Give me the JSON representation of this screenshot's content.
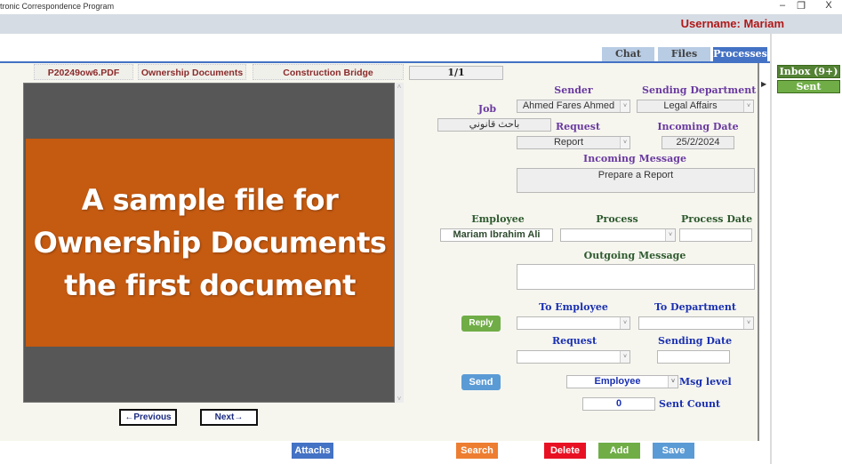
{
  "window": {
    "title": "tronic Correspondence Program",
    "minimize_glyph": "–",
    "restore_glyph": "❐",
    "close_glyph": "X"
  },
  "header": {
    "username_label": "Username: Mariam"
  },
  "tabs": [
    {
      "label": "Chat",
      "active": false
    },
    {
      "label": "Files",
      "active": false
    },
    {
      "label": "Processes",
      "active": true
    }
  ],
  "sidebar": {
    "inbox_label": "Inbox (9+)",
    "sent_label": "Sent"
  },
  "document_tabs": {
    "file_name": "P20249ow6.PDF",
    "category": "Ownership Documents",
    "project": "Construction Bridge",
    "page_counter": "1/1"
  },
  "viewer": {
    "slide_lines": [
      "A sample file for",
      "Ownership Documents",
      "the first document"
    ],
    "previous_label": "←Previous",
    "next_label": "Next→",
    "scroll_up_glyph": "˄",
    "scroll_down_glyph": "˅"
  },
  "incoming": {
    "sender_label": "Sender",
    "sender_value": "Ahmed Fares Ahmed",
    "sending_department_label": "Sending Department",
    "sending_department_value": "Legal Affairs",
    "job_label": "Job",
    "job_value": "باحث قانوني",
    "request_label": "Request",
    "request_value": "Report",
    "incoming_date_label": "Incoming Date",
    "incoming_date_value": "25/2/2024",
    "incoming_message_label": "Incoming Message",
    "incoming_message_value": "Prepare a Report"
  },
  "processing": {
    "employee_label": "Employee",
    "employee_value": "Mariam Ibrahim Ali",
    "process_label": "Process",
    "process_value": "",
    "process_date_label": "Process Date",
    "process_date_value": "",
    "outgoing_message_label": "Outgoing Message",
    "outgoing_message_value": ""
  },
  "outgoing": {
    "reply_label": "Reply",
    "to_employee_label": "To Employee",
    "to_employee_value": "",
    "to_department_label": "To Department",
    "to_department_value": "",
    "request_label": "Request",
    "request_value": "",
    "sending_date_label": "Sending Date",
    "sending_date_value": "",
    "send_label": "Send",
    "msg_level_label": "Msg level",
    "msg_level_value": "Employee",
    "sent_count_label": "Sent Count",
    "sent_count_value": "0"
  },
  "bottom_bar": {
    "attachs_label": "Attachs",
    "search_label": "Search",
    "delete_label": "Delete",
    "add_label": "Add",
    "save_label": "Save"
  },
  "colors": {
    "username": "#b01818",
    "tab_active": "#4472c4",
    "tab_inactive": "#b8cce4",
    "inbox_green": "#548235",
    "sent_green": "#70ad47",
    "slide_orange": "#c55a11",
    "attachs": "#4472c4",
    "search": "#ed7d31",
    "delete": "#e81123",
    "add": "#70ad47",
    "save": "#5b9bd5"
  }
}
